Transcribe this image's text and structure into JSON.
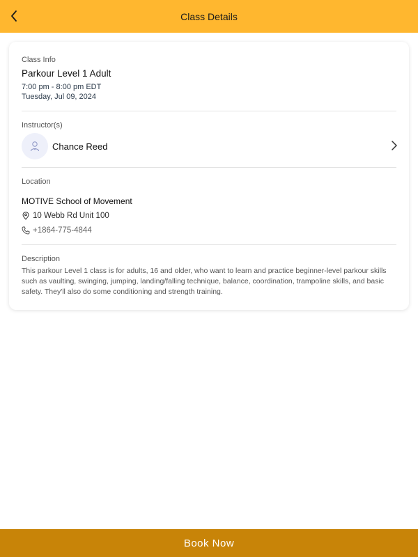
{
  "header": {
    "title": "Class Details",
    "back_icon": "chevron-left-icon",
    "background": "#FFB72F"
  },
  "class_info": {
    "label": "Class Info",
    "title": "Parkour Level 1 Adult",
    "time": "7:00 pm - 8:00 pm EDT",
    "date": "Tuesday, Jul 09, 2024"
  },
  "instructor": {
    "label": "Instructor(s)",
    "name": "Chance Reed",
    "avatar_icon": "user-icon",
    "action_icon": "chevron-right-icon"
  },
  "location": {
    "label": "Location",
    "name": "MOTIVE School of Movement",
    "address": "10 Webb Rd Unit 100",
    "address_icon": "map-pin-icon",
    "phone": "+1864-775-4844",
    "phone_icon": "phone-icon"
  },
  "description": {
    "label": "Description",
    "text": "This parkour Level 1 class is for adults, 16 and older, who want to learn and practice beginner-level parkour skills such as vaulting, swinging, jumping, landing/falling technique, balance, coordination, trampoline skills, and basic safety. They'll also do some conditioning and strength training."
  },
  "footer": {
    "book_label": "Book Now",
    "background": "#C88408"
  }
}
